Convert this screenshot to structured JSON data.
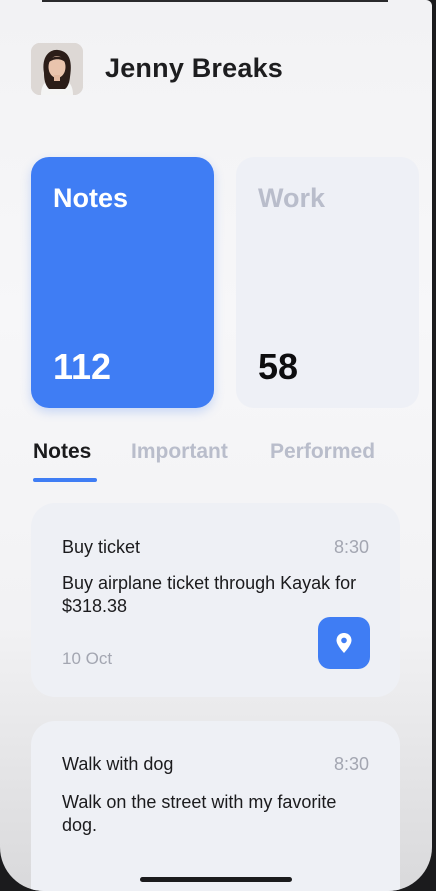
{
  "user": {
    "name": "Jenny Breaks"
  },
  "cards": [
    {
      "title": "Notes",
      "count": "112"
    },
    {
      "title": "Work",
      "count": "58"
    }
  ],
  "tabs": [
    "Notes",
    "Important",
    "Performed"
  ],
  "notes": [
    {
      "title": "Buy ticket",
      "time": "8:30",
      "body": "Buy airplane ticket through Kayak for $318.38",
      "date": "10 Oct",
      "icon": "location-pin-icon"
    },
    {
      "title": "Walk with dog",
      "time": "8:30",
      "body": "Walk on the street with my favorite dog."
    }
  ],
  "colors": {
    "accent": "#3f7df4",
    "muted": "#b9bdcb",
    "card_bg": "#eef0f5"
  }
}
